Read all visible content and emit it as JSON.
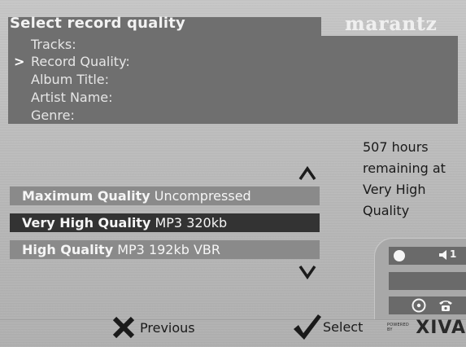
{
  "header": {
    "title": "Select record quality",
    "brand": "marantz"
  },
  "fields": [
    {
      "label": "Tracks:"
    },
    {
      "label": "Record Quality:"
    },
    {
      "label": "Album Title:"
    },
    {
      "label": "Artist Name:"
    },
    {
      "label": "Genre:"
    }
  ],
  "field_cursor": ">",
  "remaining": {
    "lines": [
      "507 hours",
      "remaining at",
      "Very High",
      "Quality"
    ]
  },
  "options": [
    {
      "name": "Maximum Quality",
      "format": "Uncompressed",
      "selected": false
    },
    {
      "name": "Very High Quality",
      "format": "MP3 320kb",
      "selected": true
    },
    {
      "name": "High Quality",
      "format": "MP3 192kb VBR",
      "selected": false
    }
  ],
  "status": {
    "volume_level": "1",
    "icons": [
      "record-dot-icon",
      "speaker-icon",
      "disc-icon",
      "phone-icon"
    ]
  },
  "footer": {
    "previous_label": "Previous",
    "select_label": "Select",
    "powered_by": "POWERED BY",
    "xiva": "XIVA"
  },
  "colors": {
    "panel": "#6f6f6f",
    "selected": "#333333",
    "option": "#8a8a8a",
    "background": "#bdbdbd"
  }
}
